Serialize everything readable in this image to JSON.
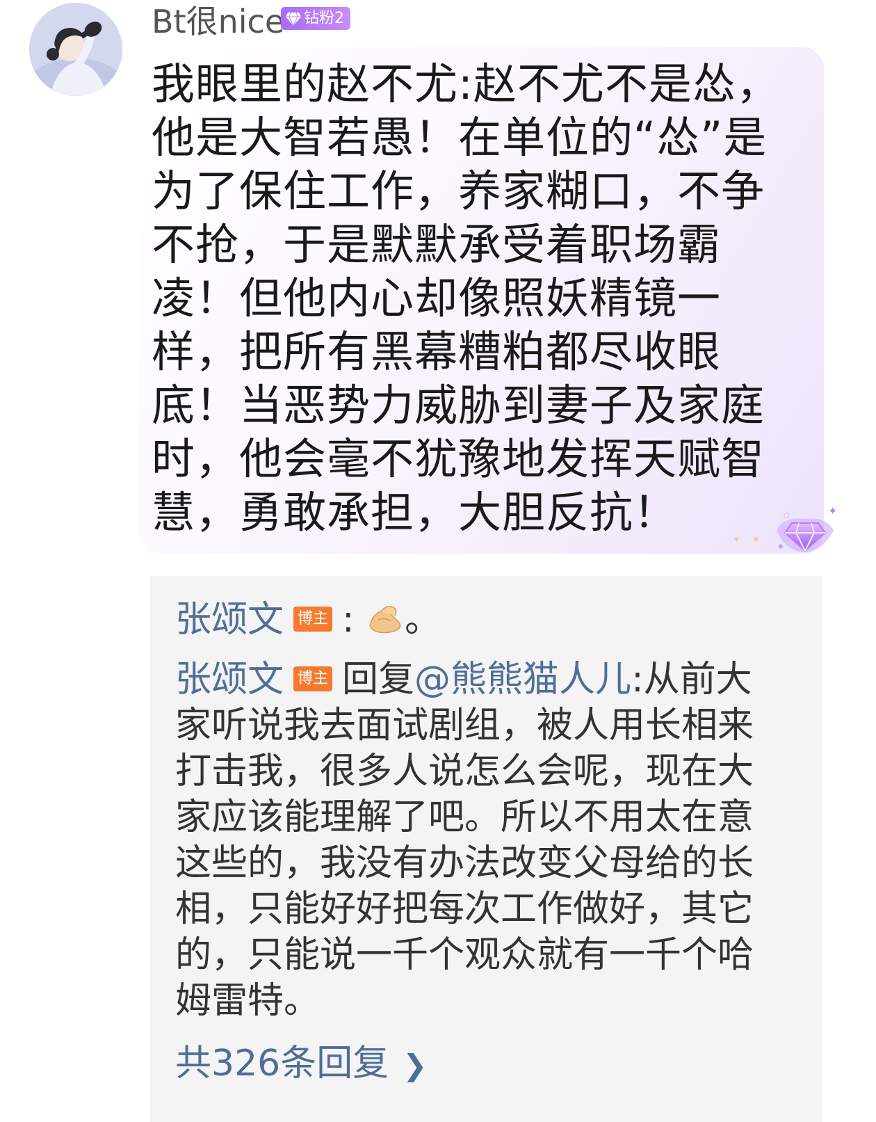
{
  "comment": {
    "username": "Bt很nice",
    "badge": "钻粉2",
    "text": "我眼里的赵不尤:赵不尤不是怂，他是大智若愚！在单位的“怂”是为了保住工作，养家糊口，不争不抢，于是默默承受着职场霸凌！但他内心却像照妖精镜一样，把所有黑幕糟粕都尽收眼底！当恶势力威胁到妻子及家庭时，他会毫不犹豫地发挥天赋智慧，勇敢承担，大胆反抗！"
  },
  "replies": {
    "items": [
      {
        "author": "张颂文",
        "badge": "博主",
        "separator": ":",
        "emoji": "pinched-fingers-emoji",
        "text": "。"
      },
      {
        "author": "张颂文",
        "badge": "博主",
        "reply_prefix": "回复",
        "mention": "@熊熊猫人儿",
        "text": ":从前大家听说我去面试剧组，被人用长相来打击我，很多人说怎么会呢，现在大家应该能理解了吧。所以不用太在意这些的，我没有办法改变父母给的长相，只能好好把每次工作做好，其它的，只能说一千个观众就有一千个哈姆雷特。"
      }
    ],
    "more_label": "共326条回复",
    "more_icon": "chevron-right-icon"
  },
  "colors": {
    "badge_purple": "#b47bf5",
    "host_badge_orange": "#f57a2f",
    "link_blue": "#4f6e97",
    "replies_bg": "#f4f4f4"
  }
}
